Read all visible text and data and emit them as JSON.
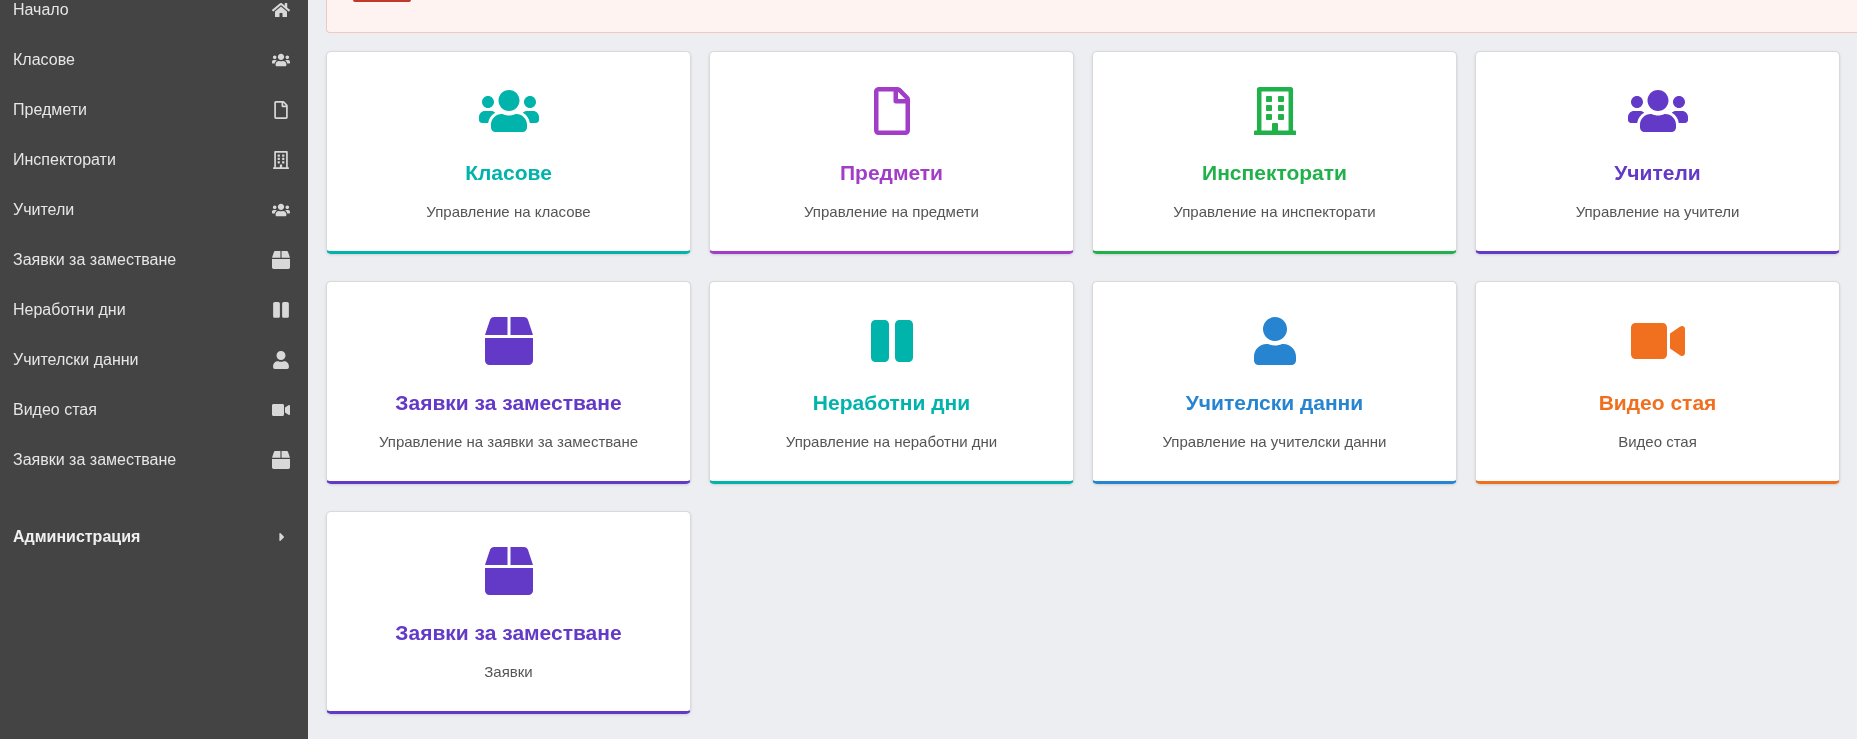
{
  "sidebar": {
    "items": [
      {
        "label": "Начало",
        "kind": "home"
      },
      {
        "label": "Класове",
        "kind": "users"
      },
      {
        "label": "Предмети",
        "kind": "file"
      },
      {
        "label": "Инспекторати",
        "kind": "building"
      },
      {
        "label": "Учители",
        "kind": "users"
      },
      {
        "label": "Заявки за заместване",
        "kind": "box"
      },
      {
        "label": "Неработни дни",
        "kind": "columns"
      },
      {
        "label": "Учителски данни",
        "kind": "user"
      },
      {
        "label": "Видео стая",
        "kind": "video"
      },
      {
        "label": "Заявки за заместване",
        "kind": "box"
      }
    ],
    "section": {
      "label": "Администрация",
      "expanded": false
    }
  },
  "cards": [
    {
      "title": "Класове",
      "description": "Управление на класове",
      "kind": "users",
      "color": "#00b3ab"
    },
    {
      "title": "Предмети",
      "description": "Управление на предмети",
      "kind": "file",
      "color": "#a23dc8"
    },
    {
      "title": "Инспекторати",
      "description": "Управление на инспекторати",
      "kind": "building",
      "color": "#21b14a"
    },
    {
      "title": "Учители",
      "description": "Управление на учители",
      "kind": "users",
      "color": "#6339c8"
    },
    {
      "title": "Заявки за заместване",
      "description": "Управление на заявки за заместване",
      "kind": "box",
      "color": "#6339c8"
    },
    {
      "title": "Неработни дни",
      "description": "Управление на неработни дни",
      "kind": "columns",
      "color": "#00b3ab"
    },
    {
      "title": "Учителски данни",
      "description": "Управление на учителски данни",
      "kind": "user",
      "color": "#2684d0"
    },
    {
      "title": "Видео стая",
      "description": "Видео стая",
      "kind": "video",
      "color": "#f07020"
    },
    {
      "title": "Заявки за заместване",
      "description": "Заявки",
      "kind": "box",
      "color": "#6339c8"
    }
  ]
}
